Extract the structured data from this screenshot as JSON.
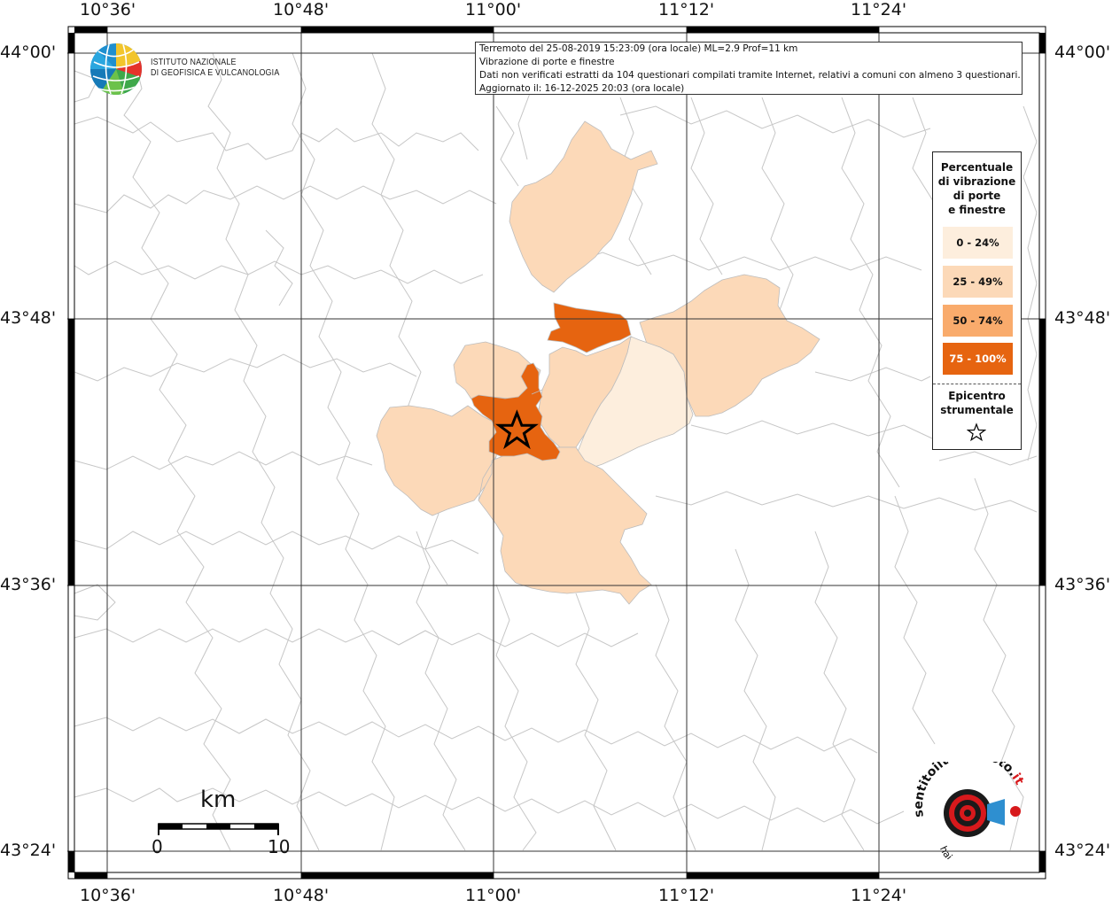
{
  "info_box": {
    "line1": "Terremoto del 25-08-2019 15:23:09 (ora locale) ML=2.9 Prof=11 km",
    "line2": "Vibrazione di porte e finestre",
    "line3": "Dati non verificati estratti da 104 questionari compilati tramite Internet, relativi a comuni con almeno 3 questionari.",
    "line4": "Aggiornato il: 16-12-2025 20:03 (ora locale)"
  },
  "ticks": {
    "lon": [
      "10°36'",
      "10°48'",
      "11°00'",
      "11°12'",
      "11°24'"
    ],
    "lat": [
      "44°00'",
      "43°48'",
      "43°36'",
      "43°24'"
    ]
  },
  "institute": {
    "line1": "ISTITUTO NAZIONALE",
    "line2": "DI GEOFISICA E VULCANOLOGIA"
  },
  "legend": {
    "title_lines": [
      "Percentuale",
      "di vibrazione",
      "di porte",
      "e finestre"
    ],
    "classes": [
      {
        "label": "0 - 24%",
        "color": "#fdeedd"
      },
      {
        "label": "25 - 49%",
        "color": "#fcd9b8"
      },
      {
        "label": "50 - 74%",
        "color": "#f9ab6c"
      },
      {
        "label": "75 - 100%",
        "color": "#e66410"
      }
    ],
    "epicenter_lines": [
      "Epicentro",
      "strumentale"
    ]
  },
  "scale_bar": {
    "unit": "km",
    "start": "0",
    "end": "10"
  },
  "epicenter": {
    "lon": 11.0247,
    "lat": 43.7161
  },
  "colors": {
    "boundary": "#c8c8c8",
    "grid": "#444444",
    "frame": "#000000",
    "accent_red": "#d7191c"
  },
  "logo_text": {
    "hst": "www.haisentitoilterremoto.it"
  }
}
